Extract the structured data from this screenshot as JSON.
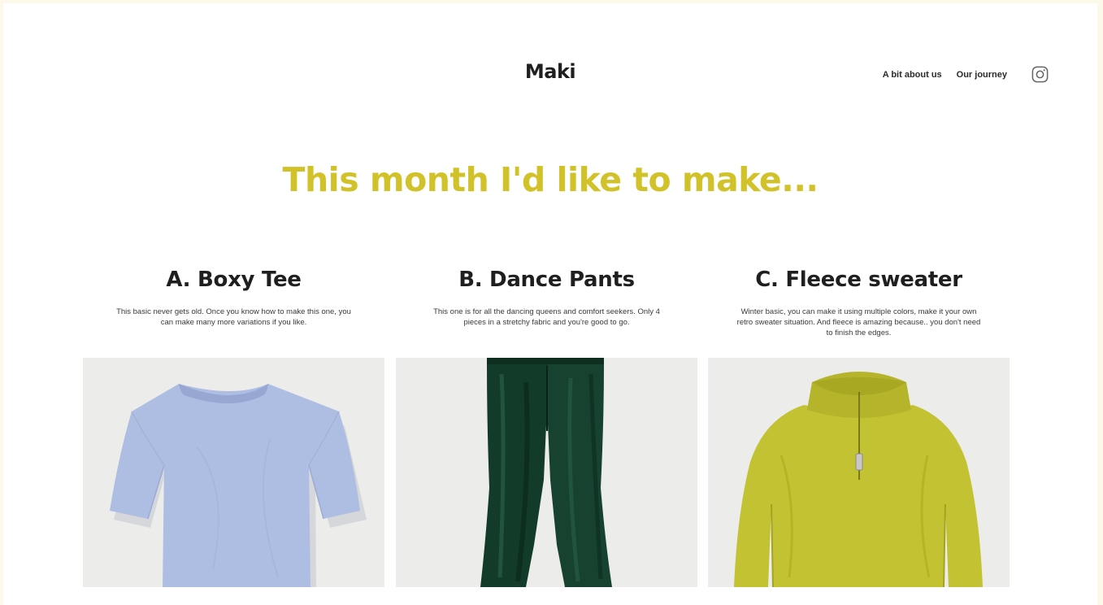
{
  "brand": {
    "logo": "Maki"
  },
  "nav": {
    "about": "A bit about us",
    "journey": "Our journey",
    "social_icon": "instagram-icon"
  },
  "headline": "This month I'd like to make...",
  "colors": {
    "accent": "#d2c22a",
    "tee": "#aebde2",
    "pants": "#133b2a",
    "sweater": "#c3c232",
    "photo_bg": "#ececea"
  },
  "products": [
    {
      "title": "A. Boxy Tee",
      "description": "This basic never gets old. Once you know how to make this one, you can make many more variations if you like.",
      "image": "light blue oversized t-shirt"
    },
    {
      "title": "B. Dance Pants",
      "description": "This one is for all the dancing queens and comfort seekers. Only 4 pieces in a stretchy fabric and you're good to go.",
      "image": "dark green velvet flared pants"
    },
    {
      "title": "C. Fleece sweater",
      "description": "Winter basic, you can make it using multiple colors, make it your own retro sweater situation. And fleece is amazing because.. you don't need to finish the edges.",
      "image": "yellow-green fleece half-zip sweater"
    }
  ]
}
